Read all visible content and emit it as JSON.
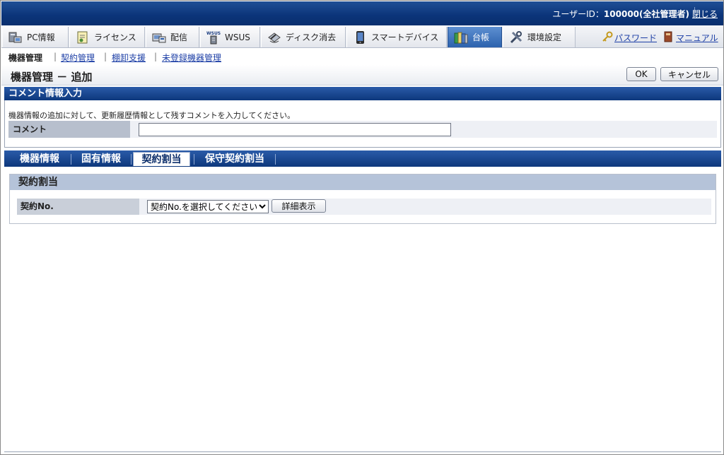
{
  "header": {
    "user_label": "ユーザーID：",
    "user_value": "100000(全社管理者)",
    "close_label": "閉じる"
  },
  "main_tabs": [
    {
      "label": "PC情報",
      "icon": "pc-icon"
    },
    {
      "label": "ライセンス",
      "icon": "license-icon"
    },
    {
      "label": "配信",
      "icon": "distribution-icon"
    },
    {
      "label": "WSUS",
      "icon": "wsus-icon"
    },
    {
      "label": "ディスク消去",
      "icon": "disk-erase-icon"
    },
    {
      "label": "スマートデバイス",
      "icon": "smart-device-icon"
    },
    {
      "label": "台帳",
      "icon": "ledger-icon",
      "active": true
    },
    {
      "label": "環境設定",
      "icon": "settings-icon"
    }
  ],
  "right_links": {
    "password": "パスワード",
    "manual": "マニュアル"
  },
  "subnav": {
    "current": "機器管理",
    "links": [
      "契約管理",
      "棚卸支援",
      "未登録機器管理"
    ]
  },
  "page": {
    "title": "機器管理 － 追加",
    "ok_label": "OK",
    "cancel_label": "キャンセル"
  },
  "comment_section": {
    "title": "コメント情報入力",
    "description": "機器情報の追加に対して、更新履歴情報として残すコメントを入力してください。",
    "field_label": "コメント",
    "field_value": ""
  },
  "content_tabs": [
    {
      "label": "機器情報"
    },
    {
      "label": "固有情報"
    },
    {
      "label": "契約割当",
      "active": true
    },
    {
      "label": "保守契約割当"
    }
  ],
  "contract_panel": {
    "title": "契約割当",
    "field_label": "契約No.",
    "select_value": "契約No.を選択してください",
    "detail_button": "詳細表示"
  },
  "colors": {
    "header_blue": "#0b3479",
    "active_tab": "#2c62ad",
    "link": "#1d3fa6"
  }
}
